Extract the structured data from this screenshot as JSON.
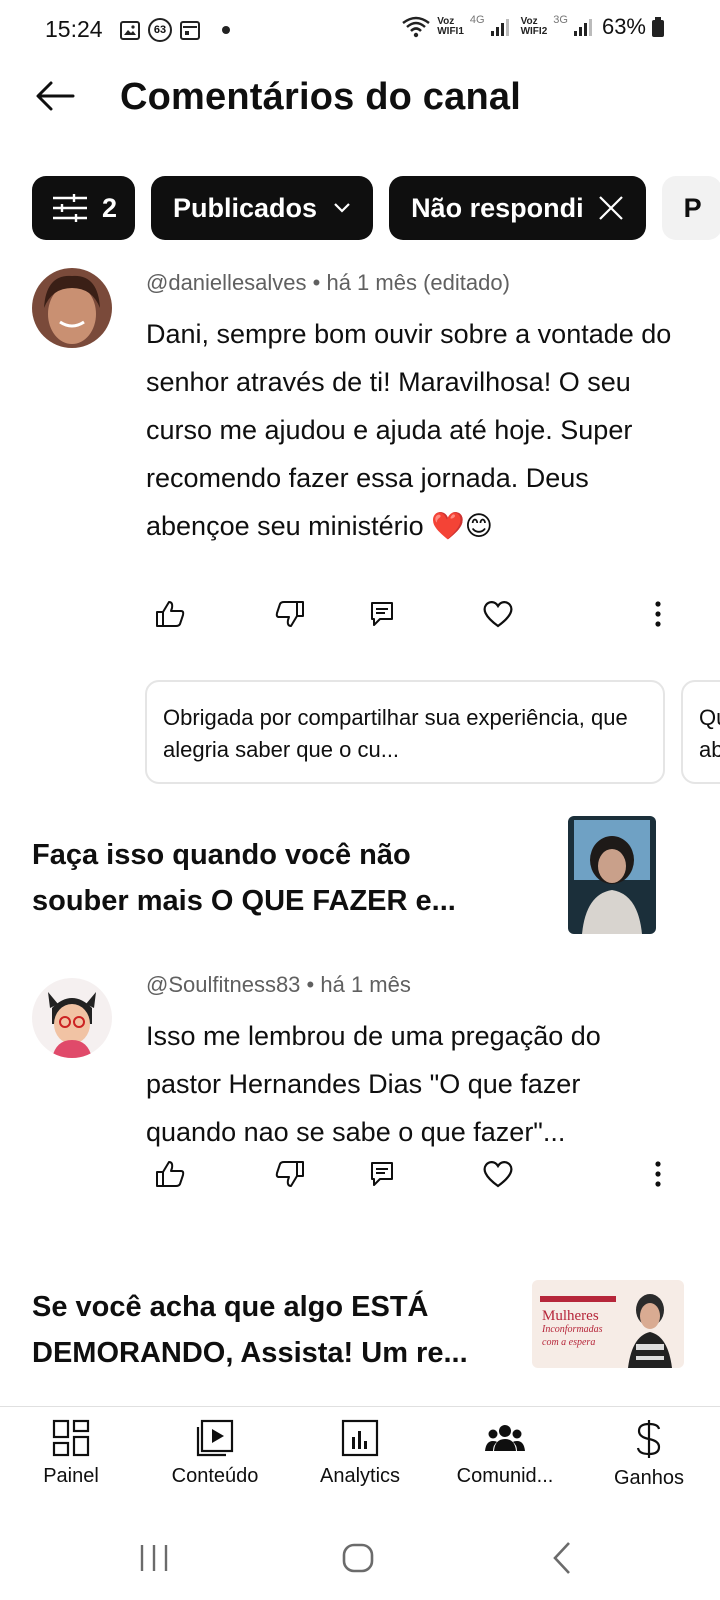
{
  "status_bar": {
    "time": "15:24",
    "notif_count": "63",
    "voz1_top": "Voz",
    "voz1_bottom": "WIFI1",
    "net1": "4G",
    "voz2_top": "Voz",
    "voz2_bottom": "WIFI2",
    "net2": "3G",
    "battery": "63%"
  },
  "header": {
    "title": "Comentários do canal"
  },
  "chips": {
    "filter_count": "2",
    "publicados": "Publicados",
    "nao_respondi": "Não respondi",
    "partial": "P"
  },
  "comments": [
    {
      "author": "@daniellesalves",
      "time": "• há 1 mês (editado)",
      "text": "Dani, sempre bom ouvir sobre a vontade do senhor através de ti! Maravilhosa! O seu curso me ajudou e ajuda até hoje. Super recomendo fazer essa jornada. Deus abençoe seu ministério ❤️😊"
    },
    {
      "author": "@Soulfitness83",
      "time": "• há 1 mês",
      "text": "Isso me lembrou de uma pregação  do pastor Hernandes Dias \"O que fazer quando nao se sabe o que fazer\"..."
    }
  ],
  "suggested_replies": [
    "Obrigada por compartilhar sua experiência, que alegria saber que o cu...",
    "Qu ab"
  ],
  "videos": [
    {
      "title": "Faça isso quando você não souber mais O QUE FAZER e..."
    },
    {
      "title": "Se você acha que algo ESTÁ DEMORANDO, Assista! Um re...",
      "thumb_text_1": "Mulheres",
      "thumb_text_2": "Inconformadas",
      "thumb_text_3": "com a espera"
    }
  ],
  "bottom_nav": [
    {
      "label": "Painel",
      "icon": "dashboard-icon"
    },
    {
      "label": "Conteúdo",
      "icon": "content-icon"
    },
    {
      "label": "Analytics",
      "icon": "analytics-icon"
    },
    {
      "label": "Comunid...",
      "icon": "community-icon"
    },
    {
      "label": "Ganhos",
      "icon": "earnings-icon"
    }
  ],
  "colors": {
    "chip_dark": "#0f0f0f",
    "text_secondary": "#606060",
    "heart": "#e0245e"
  }
}
